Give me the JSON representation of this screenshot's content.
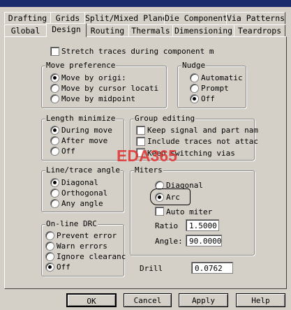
{
  "tabs_row1": [
    "Drafting",
    "Grids",
    "Split/Mixed Plane",
    "Die Component",
    "Via Patterns"
  ],
  "tabs_row2": [
    "Global",
    "Design",
    "Routing",
    "Thermals",
    "Dimensioning",
    "Teardrops"
  ],
  "active_tab": "Design",
  "stretch_traces": {
    "label": "Stretch traces during component m",
    "checked": false
  },
  "move_preference": {
    "title": "Move preference",
    "options": [
      "Move by origi:",
      "Move by cursor locati",
      "Move by midpoint"
    ],
    "selected": 0
  },
  "nudge": {
    "title": "Nudge",
    "options": [
      "Automatic",
      "Prompt",
      "Off"
    ],
    "selected": 2
  },
  "length_minimize": {
    "title": "Length minimize",
    "options": [
      "During move",
      "After move",
      "Off"
    ],
    "selected": 0
  },
  "group_editing": {
    "title": "Group editing",
    "options": [
      "Keep signal and part nam",
      "Include traces not attac",
      "Keep switching vias"
    ]
  },
  "line_trace_angle": {
    "title": "Line/trace angle",
    "options": [
      "Diagonal",
      "Orthogonal",
      "Any angle"
    ],
    "selected": 0
  },
  "miters": {
    "title": "Miters",
    "options": [
      "Diagonal",
      "Arc"
    ],
    "selected": 1,
    "auto_miter": "Auto miter",
    "ratio_label": "Ratio",
    "ratio_value": "1.5000",
    "angle_label": "Angle:",
    "angle_value": "90.0000"
  },
  "online_drc": {
    "title": "On-line DRC",
    "options": [
      "Prevent error",
      "Warn errors",
      "Ignore clearanc",
      "Off"
    ],
    "selected": 3
  },
  "drill": {
    "label": "Drill",
    "value": "0.0762"
  },
  "watermark": "EDA365",
  "buttons": {
    "ok": "OK",
    "cancel": "Cancel",
    "apply": "Apply",
    "help": "Help"
  }
}
